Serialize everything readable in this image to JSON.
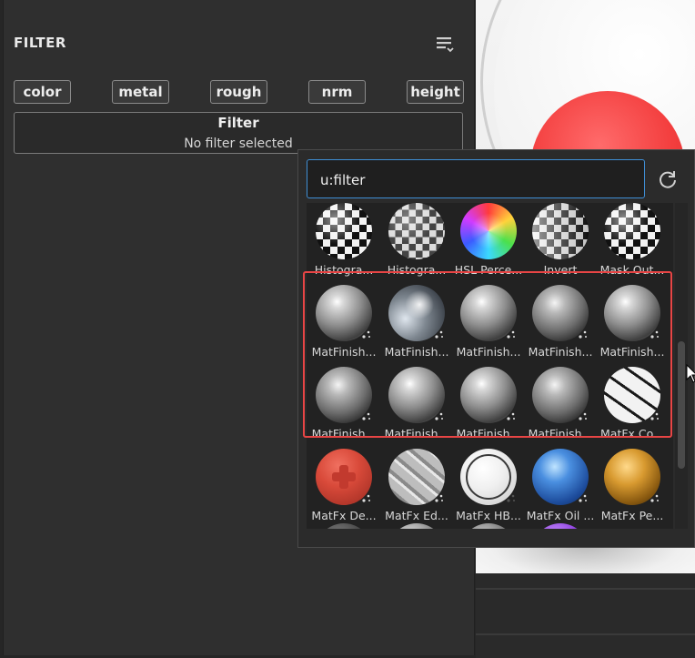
{
  "panel": {
    "title": "FILTER",
    "tags": [
      "color",
      "metal",
      "rough",
      "nrm",
      "height"
    ],
    "filter_heading": "Filter",
    "filter_status": "No filter selected"
  },
  "popup": {
    "search_value": "u:filter ",
    "row1": [
      "Histogra...",
      "Histogra...",
      "HSL Perce...",
      "Invert",
      "Mask Out..."
    ],
    "row2": [
      "MatFinish...",
      "MatFinish...",
      "MatFinish...",
      "MatFinish...",
      "MatFinish..."
    ],
    "row3": [
      "MatFinish...",
      "MatFinish...",
      "MatFinish...",
      "MatFinish...",
      "MatFx Co..."
    ],
    "row4": [
      "MatFx De...",
      "MatFx Ed...",
      "MatFx HB...",
      "MatFx Oil ...",
      "MatFx Pe..."
    ]
  },
  "colors": {
    "highlight": "#e84545",
    "search_border": "#3f8fd6"
  },
  "icons": [
    "list-filter-icon",
    "reset-icon",
    "pattern-badge-icon",
    "mouse-cursor-icon"
  ]
}
